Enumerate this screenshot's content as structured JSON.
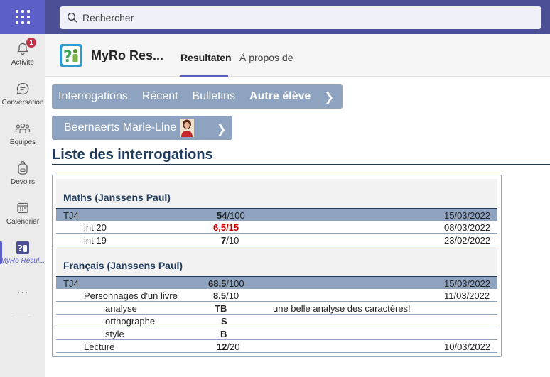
{
  "search": {
    "placeholder": "Rechercher"
  },
  "rail": {
    "items": [
      {
        "label": "Activité",
        "icon": "bell-icon",
        "badge": "1"
      },
      {
        "label": "Conversation",
        "icon": "chat-icon"
      },
      {
        "label": "Équipes",
        "icon": "teams-icon"
      },
      {
        "label": "Devoirs",
        "icon": "backpack-icon"
      },
      {
        "label": "Calendrier",
        "icon": "calendar-icon"
      },
      {
        "label": "MyRo Resul...",
        "icon": "myro-app-icon"
      }
    ],
    "more": "..."
  },
  "app": {
    "name": "MyRo Res...",
    "tabs": [
      "Resultaten",
      "À propos de"
    ]
  },
  "nav": {
    "items": [
      "Interrogations",
      "Récent",
      "Bulletins",
      "Autre élève"
    ],
    "chevron": "❯"
  },
  "student": {
    "name": "Beernaerts Marie-Line",
    "chevron": "❯"
  },
  "page_title": "Liste des interrogations",
  "sections": [
    {
      "title": "Maths (Janssens Paul)",
      "head": {
        "label": "TJ4",
        "score": "54",
        "max": "/100",
        "date": "15/03/2022"
      },
      "rows": [
        {
          "label": "int 20",
          "score": "6,5/15",
          "max": "",
          "date": "08/03/2022"
        },
        {
          "label": "int 19",
          "score": "7",
          "max": "/10",
          "date": "23/02/2022"
        }
      ]
    },
    {
      "title": "Français (Janssens Paul)",
      "head": {
        "label": "TJ4",
        "score": "68,5",
        "max": "/100",
        "date": "15/03/2022"
      },
      "rows": [
        {
          "label": "Personnages d'un livre",
          "score": "8,5",
          "max": "/10",
          "date": "11/03/2022"
        },
        {
          "label": "analyse",
          "score": "TB",
          "comment": "une belle analyse des caractères!"
        },
        {
          "label": "orthographe",
          "score": "S"
        },
        {
          "label": "style",
          "score": "B"
        },
        {
          "label": "Lecture",
          "score": "12",
          "max": "/20",
          "date": "10/03/2022"
        }
      ]
    }
  ],
  "colors": {
    "accent": "#5b5fc7",
    "topbar": "#4b4f96",
    "nav": "#8ea3bf",
    "title": "#1f3a5a",
    "fail": "#c00000"
  }
}
